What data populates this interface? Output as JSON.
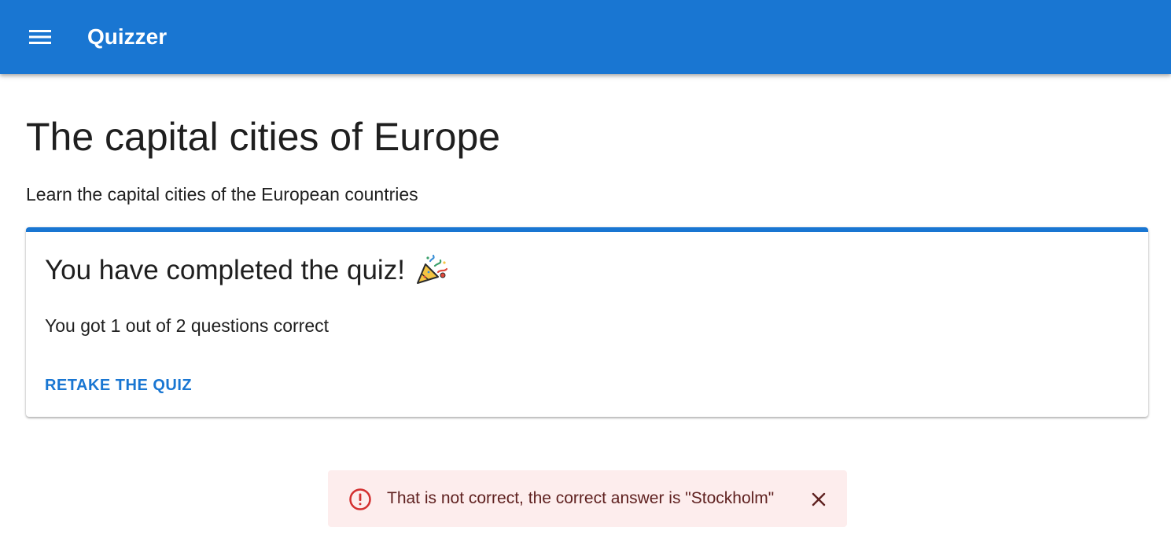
{
  "appbar": {
    "title": "Quizzer",
    "menu_icon": "hamburger-menu-icon",
    "background_color": "#1976d2"
  },
  "page": {
    "title": "The capital cities of Europe",
    "subtitle": "Learn the capital cities of the European countries"
  },
  "result_card": {
    "heading": "You have completed the quiz!",
    "heading_icon": "party-popper-icon",
    "result_text": "You got 1 out of 2 questions correct",
    "score": {
      "correct": 1,
      "total": 2
    },
    "action_label": "RETAKE THE QUIZ",
    "accent_color": "#1976d2"
  },
  "alert": {
    "severity": "error",
    "icon": "error-outline-icon",
    "message": "That is not correct, the correct answer is \"Stockholm\"",
    "close_icon": "close-icon",
    "background_color": "#fdeded",
    "text_color": "#5f2120",
    "icon_color": "#d32f2f"
  }
}
